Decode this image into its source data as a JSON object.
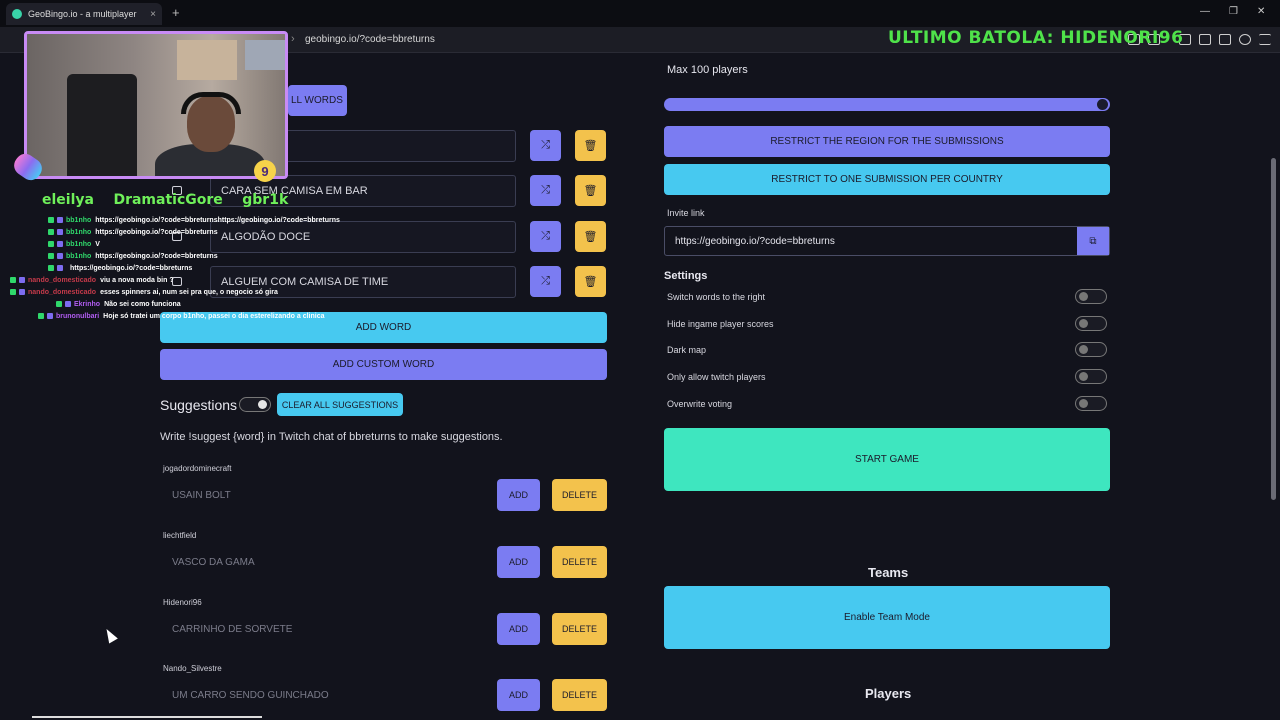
{
  "browser": {
    "tab_title": "GeoBingo.io - a multiplayer",
    "tab_close": "×",
    "new_tab": "+",
    "url": "geobingo.io/?code=bbreturns",
    "url_sep": "›",
    "min": "—",
    "max": "❐",
    "close": "✕"
  },
  "overlay": {
    "title": "ULTIMO BATOLA: HIDENORI96",
    "badge": "9",
    "subs": "eleilya    DramaticGore    gbr1k",
    "chat": [
      {
        "name": "bb1nho",
        "name_color": "#2fd86b",
        "msg": "https://geobingo.io/?code=bbreturnshttps://geobingo.io/?code=bbreturns"
      },
      {
        "name": "bb1nho",
        "name_color": "#2fd86b",
        "msg": "https://geobingo.io/?code=bbreturns"
      },
      {
        "name": "bb1nho",
        "name_color": "#2fd86b",
        "msg": "V"
      },
      {
        "name": "bb1nho",
        "name_color": "#2fd86b",
        "msg": "https://geobingo.io/?code=bbreturns"
      },
      {
        "name": "",
        "name_color": "#2a4bd7",
        "msg": "https://geobingo.io/?code=bbreturns"
      },
      {
        "name": "nando_domesticado",
        "name_color": "#c43a4a",
        "msg": "viu a nova moda bin ?"
      },
      {
        "name": "nando_domesticado",
        "name_color": "#c43a4a",
        "msg": "esses spinners ai, num sei pra que, o negocio só gira"
      },
      {
        "name": "Ekrinho",
        "name_color": "#b05cf0",
        "msg": "Não sei como funciona"
      },
      {
        "name": "brunonulbari",
        "name_color": "#b05cf0",
        "msg": "Hoje só tratei um corpo b1nho, passei o dia esterelizando a clinica"
      }
    ]
  },
  "words": {
    "clear_label": "CLEAR ALL WORDS",
    "clear_visible": "LL WORDS",
    "items": [
      {
        "text": ""
      },
      {
        "text": "CARA SEM CAMISA EM BAR"
      },
      {
        "text": "ALGODÃO DOCE"
      },
      {
        "text": "ALGUEM COM CAMISA DE TIME"
      }
    ],
    "shuffle_icon": "⤮",
    "delete_icon": "🗑",
    "add_word": "ADD WORD",
    "add_custom": "ADD CUSTOM WORD"
  },
  "suggestions": {
    "title": "Suggestions",
    "toggle_on": true,
    "clear_all": "CLEAR ALL SUGGESTIONS",
    "hint": "Write !suggest {word} in Twitch chat of bbreturns to make suggestions.",
    "add_label": "ADD",
    "delete_label": "DELETE",
    "items": [
      {
        "user": "jogadordominecraft",
        "word": "USAIN BOLT"
      },
      {
        "user": "liechtfield",
        "word": "VASCO DA GAMA"
      },
      {
        "user": "Hidenori96",
        "word": "CARRINHO DE SORVETE"
      },
      {
        "user": "Nando_Silvestre",
        "word": "UM CARRO SENDO GUINCHADO"
      }
    ]
  },
  "lobby": {
    "max_players": "Max 100 players",
    "slider_value": 100,
    "restrict_region": "RESTRICT THE REGION FOR THE SUBMISSIONS",
    "restrict_one": "RESTRICT TO ONE SUBMISSION PER COUNTRY",
    "invite_label": "Invite link",
    "invite_url": "https://geobingo.io/?code=bbreturns",
    "copy_icon": "⧉",
    "settings_title": "Settings",
    "settings": [
      {
        "label": "Switch words to the right",
        "on": false
      },
      {
        "label": "Hide ingame player scores",
        "on": false
      },
      {
        "label": "Dark map",
        "on": false
      },
      {
        "label": "Only allow twitch players",
        "on": false
      },
      {
        "label": "Overwrite voting",
        "on": false
      }
    ],
    "start_game": "START GAME",
    "teams_title": "Teams",
    "enable_teams": "Enable Team Mode",
    "players_title": "Players"
  },
  "colors": {
    "purple": "#7b7cf2",
    "cyan": "#47c9f0",
    "yellow": "#f3c24c",
    "green": "#3ee6bf",
    "overlay_green": "#4fe24a"
  }
}
